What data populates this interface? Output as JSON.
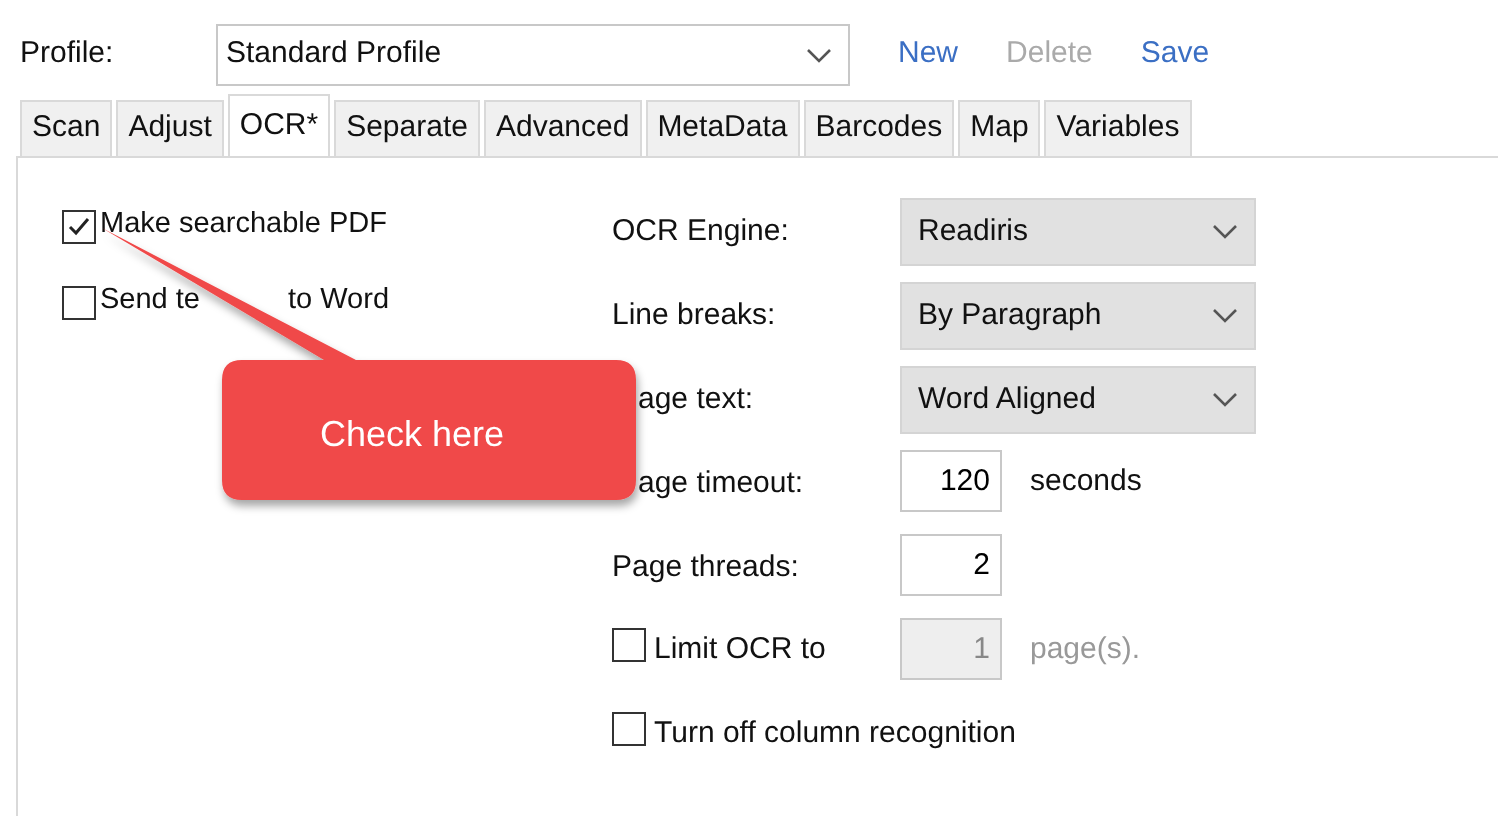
{
  "profile": {
    "label": "Profile:",
    "value": "Standard Profile",
    "actions": [
      {
        "label": "New",
        "disabled": false
      },
      {
        "label": "Delete",
        "disabled": true
      },
      {
        "label": "Save",
        "disabled": false
      }
    ]
  },
  "tabs": [
    {
      "label": "Scan",
      "selected": false
    },
    {
      "label": "Adjust",
      "selected": false
    },
    {
      "label": "OCR*",
      "selected": true
    },
    {
      "label": "Separate",
      "selected": false
    },
    {
      "label": "Advanced",
      "selected": false
    },
    {
      "label": "MetaData",
      "selected": false
    },
    {
      "label": "Barcodes",
      "selected": false
    },
    {
      "label": "Map",
      "selected": false
    },
    {
      "label": "Variables",
      "selected": false
    }
  ],
  "left_options": [
    {
      "parts": [
        "Make searchable PDF"
      ],
      "checked": true
    },
    {
      "parts": [
        "Send te",
        "to Word"
      ],
      "checked": false
    }
  ],
  "settings": [
    {
      "kind": "select",
      "label": "OCR Engine:",
      "value": "Readiris",
      "partly_hidden": false
    },
    {
      "kind": "select",
      "label": "Line breaks:",
      "value": "By Paragraph",
      "partly_hidden": false
    },
    {
      "kind": "select",
      "label": "age text:",
      "value": "Word Aligned",
      "partly_hidden": true
    },
    {
      "kind": "number",
      "label": "age timeout:",
      "value": "120",
      "unit": "seconds",
      "partly_hidden": true
    },
    {
      "kind": "number",
      "label": "Page threads:",
      "value": "2",
      "partly_hidden": false
    },
    {
      "kind": "check_number",
      "label": "Limit OCR to",
      "checked": false,
      "value": "1",
      "unit": "page(s).",
      "disabled": true
    },
    {
      "kind": "check",
      "label": "Turn off column recognition",
      "checked": false
    }
  ],
  "callout": {
    "text": "Check here"
  }
}
